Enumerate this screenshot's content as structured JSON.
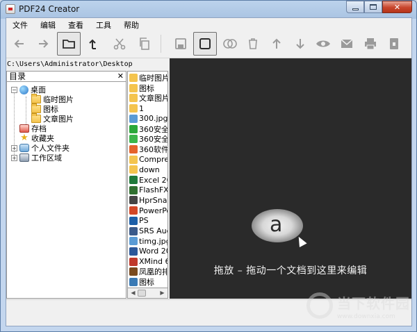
{
  "window": {
    "title": "PDF24 Creator",
    "controls": {
      "minimize": "",
      "maximize": "",
      "close": "✕"
    }
  },
  "menu": [
    "文件",
    "编辑",
    "查看",
    "工具",
    "帮助"
  ],
  "toolbar": {
    "icons": [
      "arrow-left-icon",
      "arrow-right-icon",
      "folder-icon",
      "up-folder-icon",
      "cut-icon",
      "copy-icon",
      "save-icon",
      "square-icon",
      "merge-icon",
      "delete-icon",
      "arrow-up-icon",
      "arrow-down-icon",
      "preview-icon",
      "email-icon",
      "print-icon",
      "compress-icon"
    ]
  },
  "path": "C:\\Users\\Administrator\\Desktop",
  "tree": {
    "header": "目录",
    "close": "✕",
    "items": [
      {
        "label": "桌面",
        "icon": "desktop-icon",
        "level": 1
      },
      {
        "label": "临时图片",
        "icon": "folder-icon",
        "level": 2
      },
      {
        "label": "图标",
        "icon": "folder-icon",
        "level": 2
      },
      {
        "label": "文章图片",
        "icon": "folder-icon",
        "level": 2
      },
      {
        "label": "存档",
        "icon": "archive-icon",
        "level": 1
      },
      {
        "label": "收藏夹",
        "icon": "star-icon",
        "level": 1
      },
      {
        "label": "个人文件夹",
        "icon": "user-folder-icon",
        "level": 1
      },
      {
        "label": "工作区域",
        "icon": "workspace-icon",
        "level": 1
      }
    ]
  },
  "files": [
    {
      "name": "临时图片",
      "color": "#f4c44e"
    },
    {
      "name": "图标",
      "color": "#f4c44e"
    },
    {
      "name": "文章图片",
      "color": "#f4c44e"
    },
    {
      "name": "1",
      "color": "#f4c44e"
    },
    {
      "name": "300.jpg",
      "color": "#5a9bd5"
    },
    {
      "name": "360安全卫",
      "color": "#2aa83a"
    },
    {
      "name": "360安全浏",
      "color": "#3bb54a"
    },
    {
      "name": "360软件管",
      "color": "#e5622b"
    },
    {
      "name": "Compres",
      "color": "#f4c44e"
    },
    {
      "name": "down",
      "color": "#f4c44e"
    },
    {
      "name": "Excel 20",
      "color": "#1f7a3a"
    },
    {
      "name": "FlashFXP",
      "color": "#2f6f2f"
    },
    {
      "name": "HprSnap",
      "color": "#444444"
    },
    {
      "name": "PowerPo",
      "color": "#d24726"
    },
    {
      "name": "PS",
      "color": "#1c5fa8"
    },
    {
      "name": "SRS Aud",
      "color": "#3a5a8a"
    },
    {
      "name": "timg.jpg",
      "color": "#5a9bd5"
    },
    {
      "name": "Word 20",
      "color": "#2b579a"
    },
    {
      "name": "XMind 6",
      "color": "#c0392b"
    },
    {
      "name": "凤凰的排",
      "color": "#7a4a1e"
    },
    {
      "name": "图标",
      "color": "#3a7ab5"
    }
  ],
  "dropzone": {
    "logo_letter": "a",
    "text": "拖放 – 拖动一个文档到这里来编辑"
  },
  "watermark": {
    "title": "当下软件园",
    "url": "www.downxia.com"
  }
}
